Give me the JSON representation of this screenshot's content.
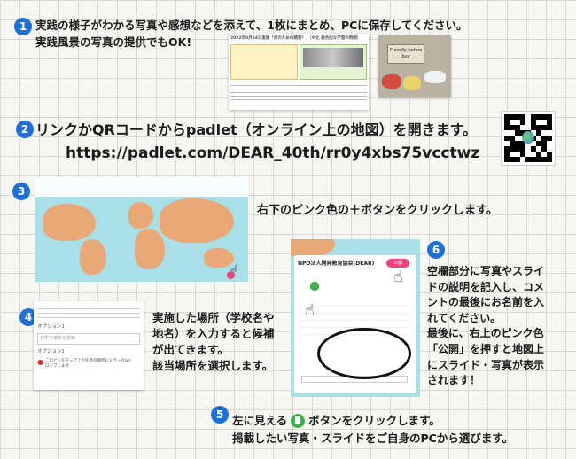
{
  "step1": {
    "num": "1",
    "line1": "実践の様子がわかる写真や感想などを添えて、1枚にまとめ、PCに保存してください。",
    "line2": "実践風景の写真の提供でもOK!",
    "doc_title": "2022年8月24日実施「何のための開発？」（中北 総合的な学習の時間）",
    "photo_sign": "Classify before buy"
  },
  "step2": {
    "num": "2",
    "line1": "リンクかQRコードからpadlet（オンライン上の地図）を開きます。",
    "url": "https://padlet.com/DEAR_40th/rr0y4xbs75vcctwz"
  },
  "step3": {
    "num": "3",
    "text": "右下のピンク色の＋ボタンをクリックします。"
  },
  "step4": {
    "num": "4",
    "text": [
      "実施した場所（学校名や",
      "地名）を入力すると候補",
      "が出てきます。",
      "該当場所を選択します。"
    ],
    "panel_label": "オプション1",
    "panel_placeholder": "住所で場所を検索",
    "panel_item": "このピンをマップ上の任意の場所にドラッグ&ドロップします"
  },
  "step5": {
    "num": "5",
    "line1_pre": "左に見える",
    "line1_post": "ボタンをクリックします。",
    "line2": "掲載したい写真・スライドをご自身のPCから選びます。"
  },
  "step6": {
    "num": "6",
    "text": [
      "空欄部分に写真やスライ",
      "ドの説明を記入し、コメ",
      "ントの最後にお名前を入",
      "れてください。",
      "最後に、右上のピンク色",
      "「公開」を押すと地図上",
      "にスライド・写真が表示",
      "されます！"
    ],
    "panel_org": "NPO法人開発教育協会(DEAR)",
    "panel_publish": "公開"
  },
  "colors": {
    "number_badge": "#1f6fd6",
    "pink": "#e8457a",
    "map_sea": "#a9dfe7",
    "map_land": "#e9a878"
  },
  "icons": [
    "pointer-hand-icon",
    "qr-code-icon",
    "plus-button-icon",
    "attachment-icon"
  ]
}
